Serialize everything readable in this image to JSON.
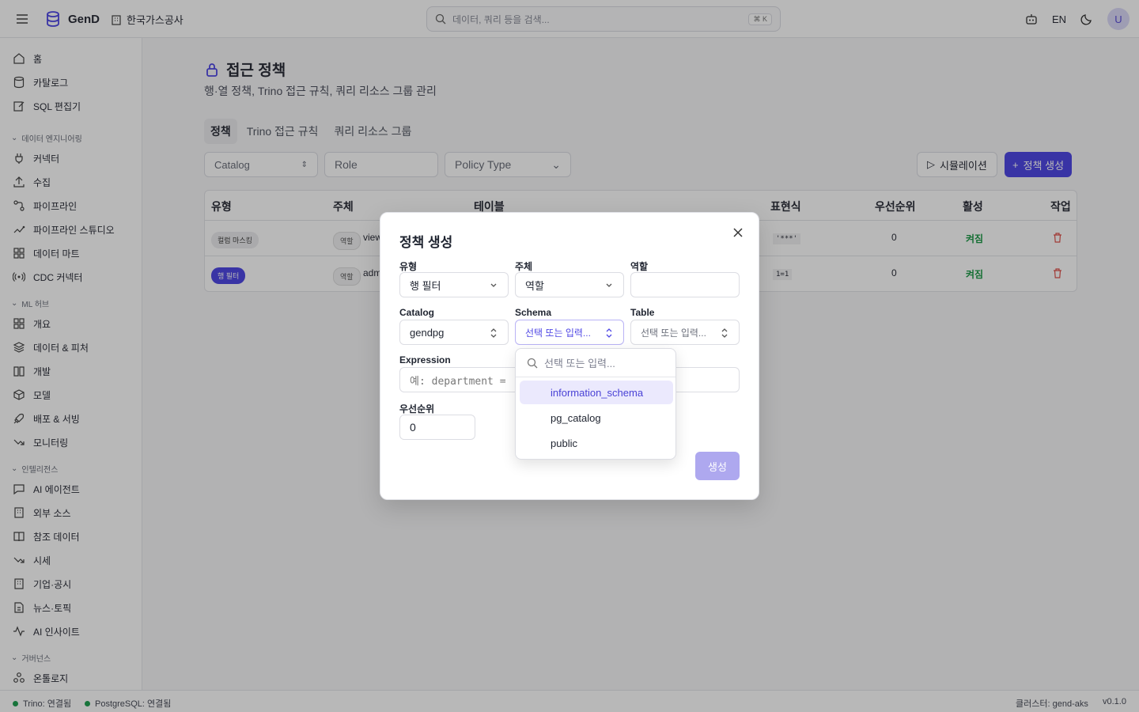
{
  "header": {
    "brand": "GenD",
    "org": "한국가스공사",
    "search_placeholder": "데이터, 쿼리 등을 검색...",
    "search_shortcut": "⌘ K",
    "lang": "EN",
    "avatar_initial": "U"
  },
  "sidebar": {
    "top_items": [
      "홈",
      "카탈로그",
      "SQL 편집기"
    ],
    "groups": [
      {
        "label": "데이터 엔지니어링",
        "items": [
          "커넥터",
          "수집",
          "파이프라인",
          "파이프라인 스튜디오",
          "데이터 마트",
          "CDC 커넥터"
        ]
      },
      {
        "label": "ML 허브",
        "items": [
          "개요",
          "데이터 & 피처",
          "개발",
          "모델",
          "배포 & 서빙",
          "모니터링"
        ]
      },
      {
        "label": "인텔리전스",
        "items": [
          "AI 에이전트",
          "외부 소스",
          "참조 데이터",
          "시세",
          "기업·공시",
          "뉴스·토픽",
          "AI 인사이트"
        ]
      },
      {
        "label": "거버넌스",
        "items": [
          "온톨로지"
        ]
      }
    ]
  },
  "page": {
    "title": "접근 정책",
    "subtitle": "행·열 정책, Trino 접근 규칙, 쿼리 리소스 그룹 관리",
    "tabs": [
      "정책",
      "Trino 접근 규칙",
      "쿼리 리소스 그룹"
    ],
    "filters": {
      "catalog": "Catalog",
      "role": "Role",
      "policy_type": "Policy Type"
    },
    "simulate_label": "시뮬레이션",
    "create_label": "정책 생성"
  },
  "table": {
    "headers": [
      "유형",
      "주체",
      "테이블",
      "표현식",
      "우선순위",
      "활성",
      "작업"
    ],
    "rows": [
      {
        "type": "컬럼 마스킹",
        "subject_kind": "역할",
        "subject": "view",
        "expression": "'***'",
        "priority": "0",
        "active": "켜짐"
      },
      {
        "type": "행 필터",
        "subject_kind": "역할",
        "subject": "adm",
        "expression": "1=1",
        "priority": "0",
        "active": "켜짐"
      }
    ]
  },
  "modal": {
    "title": "정책 생성",
    "type_label": "유형",
    "type_value": "행 필터",
    "subject_label": "주체",
    "subject_value": "역할",
    "role_label": "역할",
    "role_value": "",
    "catalog_label": "Catalog",
    "catalog_value": "gendpg",
    "schema_label": "Schema",
    "schema_value": "선택 또는 입력...",
    "table_label": "Table",
    "table_value": "선택 또는 입력...",
    "expression_label": "Expression",
    "expression_placeholder": "예: department = ",
    "priority_label": "우선순위",
    "priority_value": "0",
    "submit": "생성"
  },
  "dropdown": {
    "search_placeholder": "선택 또는 입력...",
    "options": [
      "information_schema",
      "pg_catalog",
      "public"
    ]
  },
  "status": {
    "trino": "Trino: 연결됨",
    "postgres": "PostgreSQL: 연결됨",
    "cluster": "클러스터: gend-aks",
    "version": "v0.1.0"
  },
  "colors": {
    "accent": "#5048e5",
    "success": "#1d9a47",
    "danger": "#e0514b"
  }
}
